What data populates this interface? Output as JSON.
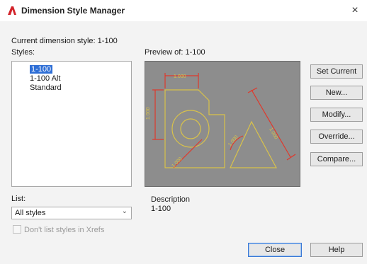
{
  "window": {
    "title": "Dimension Style Manager",
    "close_glyph": "×",
    "app_icon": "autocad-a-icon"
  },
  "current_style": {
    "label": "Current dimension style: 1-100"
  },
  "styles": {
    "label": "Styles:",
    "items": [
      {
        "label": "1-100",
        "selected": true
      },
      {
        "label": "1-100 Alt",
        "selected": false
      },
      {
        "label": "Standard",
        "selected": false
      }
    ]
  },
  "list_filter": {
    "label": "List:",
    "selected_value": "All styles"
  },
  "xref_checkbox": {
    "label": "Don't list styles in Xrefs",
    "checked": false,
    "enabled": false
  },
  "preview": {
    "label": "Preview of: 1-100",
    "dimension_texts": [
      "1.000",
      "1.000",
      "1.000",
      "1.000",
      "1.000"
    ]
  },
  "description": {
    "label": "Description",
    "value": "1-100"
  },
  "buttons": {
    "set_current": "Set Current",
    "new": "New...",
    "modify": "Modify...",
    "override": "Override...",
    "compare": "Compare...",
    "close": "Close",
    "help": "Help"
  },
  "colors": {
    "preview_bg": "#8d8d8d",
    "preview_geometry": "#d9c24a",
    "preview_dims": "#e0382b",
    "selection": "#2f6fd6",
    "app_icon": "#d2232a"
  }
}
